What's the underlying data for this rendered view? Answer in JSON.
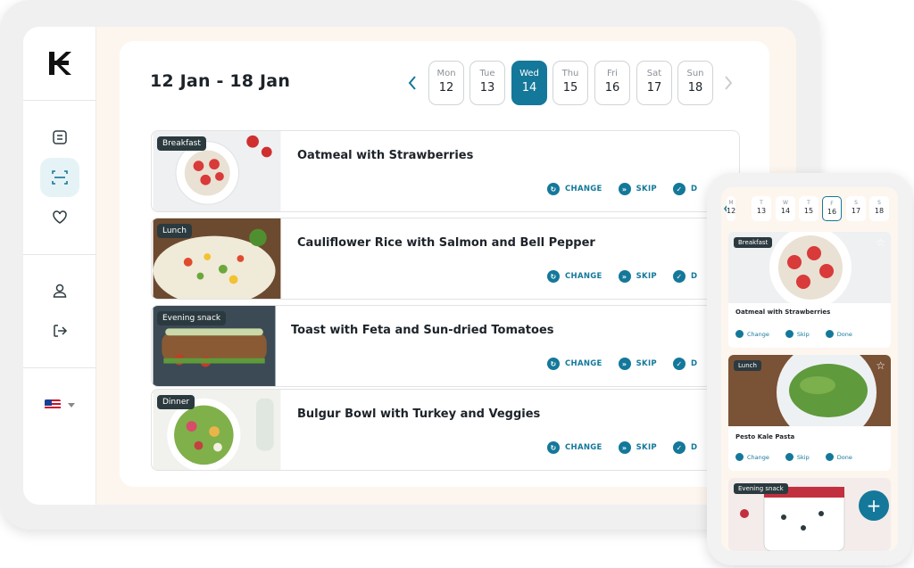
{
  "brand": {
    "logo_letter": "K",
    "accent": "#14789a"
  },
  "sidebar": {
    "icons": [
      "notes-icon",
      "scan-icon",
      "heart-icon",
      "profile-icon",
      "logout-icon"
    ],
    "language": "en-US"
  },
  "week": {
    "title": "12 Jan - 18 Jan",
    "days": [
      {
        "name": "Mon",
        "date": "12"
      },
      {
        "name": "Tue",
        "date": "13"
      },
      {
        "name": "Wed",
        "date": "14",
        "selected": true
      },
      {
        "name": "Thu",
        "date": "15"
      },
      {
        "name": "Fri",
        "date": "16"
      },
      {
        "name": "Sat",
        "date": "17"
      },
      {
        "name": "Sun",
        "date": "18"
      }
    ]
  },
  "meals": [
    {
      "tag": "Breakfast",
      "title": "Oatmeal with Strawberries"
    },
    {
      "tag": "Lunch",
      "title": "Cauliflower Rice with Salmon and Bell Pepper"
    },
    {
      "tag": "Evening snack",
      "title": "Toast with Feta and Sun-dried Tomatoes"
    },
    {
      "tag": "Dinner",
      "title": "Bulgur Bowl with Turkey and Veggies"
    }
  ],
  "actions": {
    "change": "CHANGE",
    "skip": "SKIP",
    "done": "D"
  },
  "phone": {
    "days": [
      {
        "name": "T",
        "date": "13"
      },
      {
        "name": "W",
        "date": "14"
      },
      {
        "name": "T",
        "date": "15"
      },
      {
        "name": "F",
        "date": "16",
        "selected": true
      },
      {
        "name": "S",
        "date": "17"
      },
      {
        "name": "S",
        "date": "18"
      }
    ],
    "left_partial": {
      "name": "M",
      "date": "12"
    },
    "meals": [
      {
        "tag": "Breakfast",
        "title": "Oatmeal with Strawberries"
      },
      {
        "tag": "Lunch",
        "title": "Pesto Kale Pasta"
      },
      {
        "tag": "Evening snack",
        "title": ""
      }
    ],
    "actions": {
      "change": "Change",
      "skip": "Skip",
      "done": "Done"
    },
    "fab": "+"
  }
}
